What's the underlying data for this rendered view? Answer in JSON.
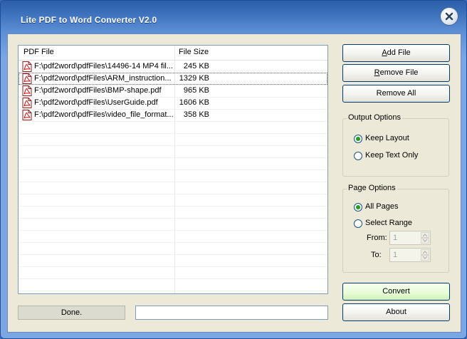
{
  "window": {
    "title": "Lite PDF to Word Converter V2.0"
  },
  "file_list": {
    "columns": [
      "PDF File",
      "File Size"
    ],
    "rows": [
      {
        "name": "F:\\pdf2word\\pdfFiles\\14496-14 MP4 fil...",
        "size": "245 KB"
      },
      {
        "name": "F:\\pdf2word\\pdfFiles\\ARM_instruction...",
        "size": "1329 KB"
      },
      {
        "name": "F:\\pdf2word\\pdfFiles\\BMP-shape.pdf",
        "size": "965 KB"
      },
      {
        "name": "F:\\pdf2word\\pdfFiles\\UserGuide.pdf",
        "size": "1606 KB"
      },
      {
        "name": "F:\\pdf2word\\pdfFiles\\video_file_format...",
        "size": "358 KB"
      }
    ],
    "selected_row": 1
  },
  "buttons": {
    "add_file_underline": "A",
    "add_file_rest": "dd File",
    "remove_file_underline": "R",
    "remove_file_rest": "emove File",
    "remove_all": "Remove All",
    "convert": "Convert",
    "about": "About"
  },
  "output_options": {
    "title": "Output Options",
    "keep_layout": "Keep Layout",
    "keep_text_only": "Keep Text Only",
    "selected": "Keep Layout"
  },
  "page_options": {
    "title": "Page Options",
    "all_pages": "All Pages",
    "select_range": "Select Range",
    "selected": "All Pages",
    "from_label": "From:",
    "from_value": "1",
    "to_label": "To:",
    "to_value": "1"
  },
  "status": {
    "text": "Done.",
    "progress": 0
  },
  "colors": {
    "title_bar": "#3f73bd",
    "client": "#ece9d8",
    "radio_dot": "#20a020",
    "convert_button": "#e7fbd6"
  },
  "icons": {
    "close": "close-icon",
    "file": "pdf-file-icon",
    "spin_up": "arrow-up-icon",
    "spin_down": "arrow-down-icon"
  }
}
